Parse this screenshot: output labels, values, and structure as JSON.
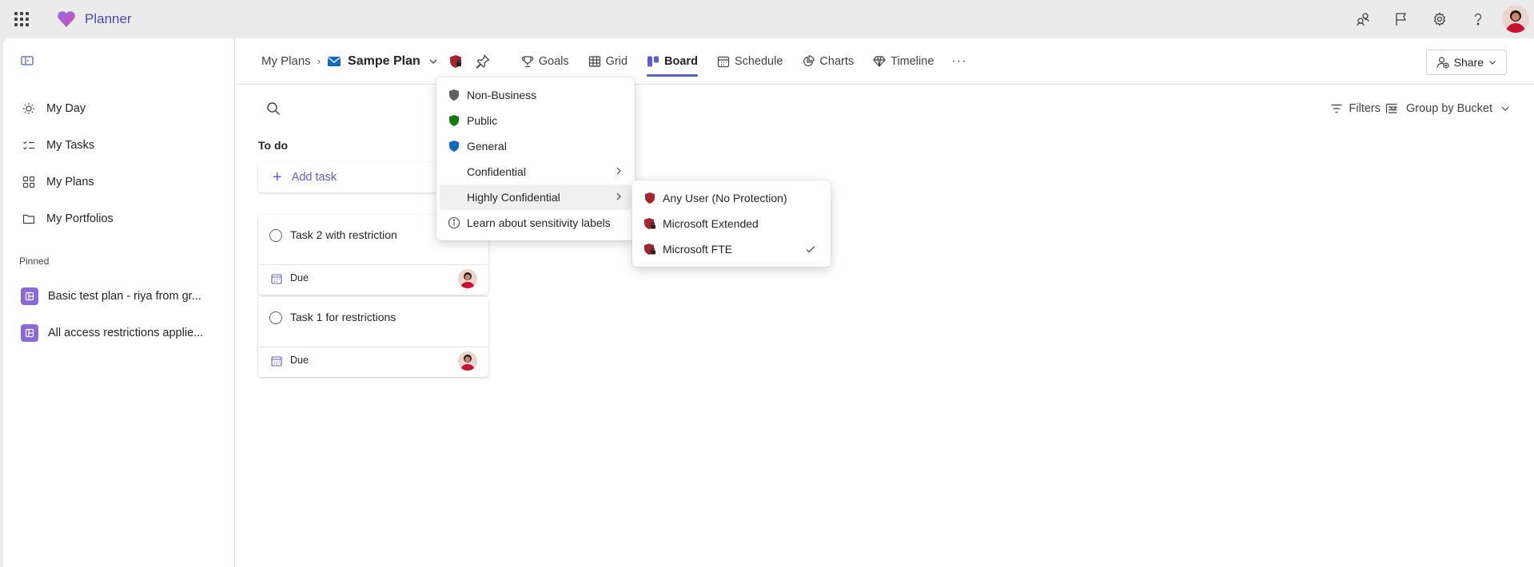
{
  "app": {
    "name": "Planner"
  },
  "topbar": {
    "icons": [
      "feedback-icon",
      "flag-icon",
      "settings-icon",
      "help-icon"
    ]
  },
  "sidebar": {
    "items": [
      {
        "label": "My Day",
        "icon": "sun-icon"
      },
      {
        "label": "My Tasks",
        "icon": "tasks-icon"
      },
      {
        "label": "My Plans",
        "icon": "grid-icon"
      },
      {
        "label": "My Portfolios",
        "icon": "folder-icon"
      }
    ],
    "pinned_title": "Pinned",
    "pinned": [
      {
        "label": "Basic test plan - riya from gr..."
      },
      {
        "label": "All access restrictions applie..."
      }
    ]
  },
  "header": {
    "breadcrumb_root": "My Plans",
    "plan_title": "Sampe Plan",
    "tabs": [
      {
        "label": "Goals"
      },
      {
        "label": "Grid"
      },
      {
        "label": "Board"
      },
      {
        "label": "Schedule"
      },
      {
        "label": "Charts"
      },
      {
        "label": "Timeline"
      }
    ],
    "more": "···",
    "share": "Share"
  },
  "toolbar": {
    "filters": "Filters",
    "group_by": "Group by Bucket"
  },
  "board": {
    "bucket": "To do",
    "add_task": "Add task",
    "tasks": [
      {
        "title": "Task 2 with restriction",
        "due": "Due"
      },
      {
        "title": "Task 1 for restrictions",
        "due": "Due"
      }
    ]
  },
  "sensitivity_menu": {
    "items": [
      {
        "label": "Non-Business",
        "color": "#616161"
      },
      {
        "label": "Public",
        "color": "#107c10"
      },
      {
        "label": "General",
        "color": "#0f6cbd"
      },
      {
        "label": "Confidential"
      },
      {
        "label": "Highly Confidential"
      },
      {
        "label": "Learn about sensitivity labels"
      }
    ],
    "submenu": [
      {
        "label": "Any User (No Protection)",
        "color": "#a4262c"
      },
      {
        "label": "Microsoft Extended",
        "color": "#a4262c"
      },
      {
        "label": "Microsoft FTE",
        "color": "#a4262c",
        "selected": true
      }
    ]
  },
  "colors": {
    "accent": "#5b5fc7",
    "brand": "#4b46b8"
  }
}
